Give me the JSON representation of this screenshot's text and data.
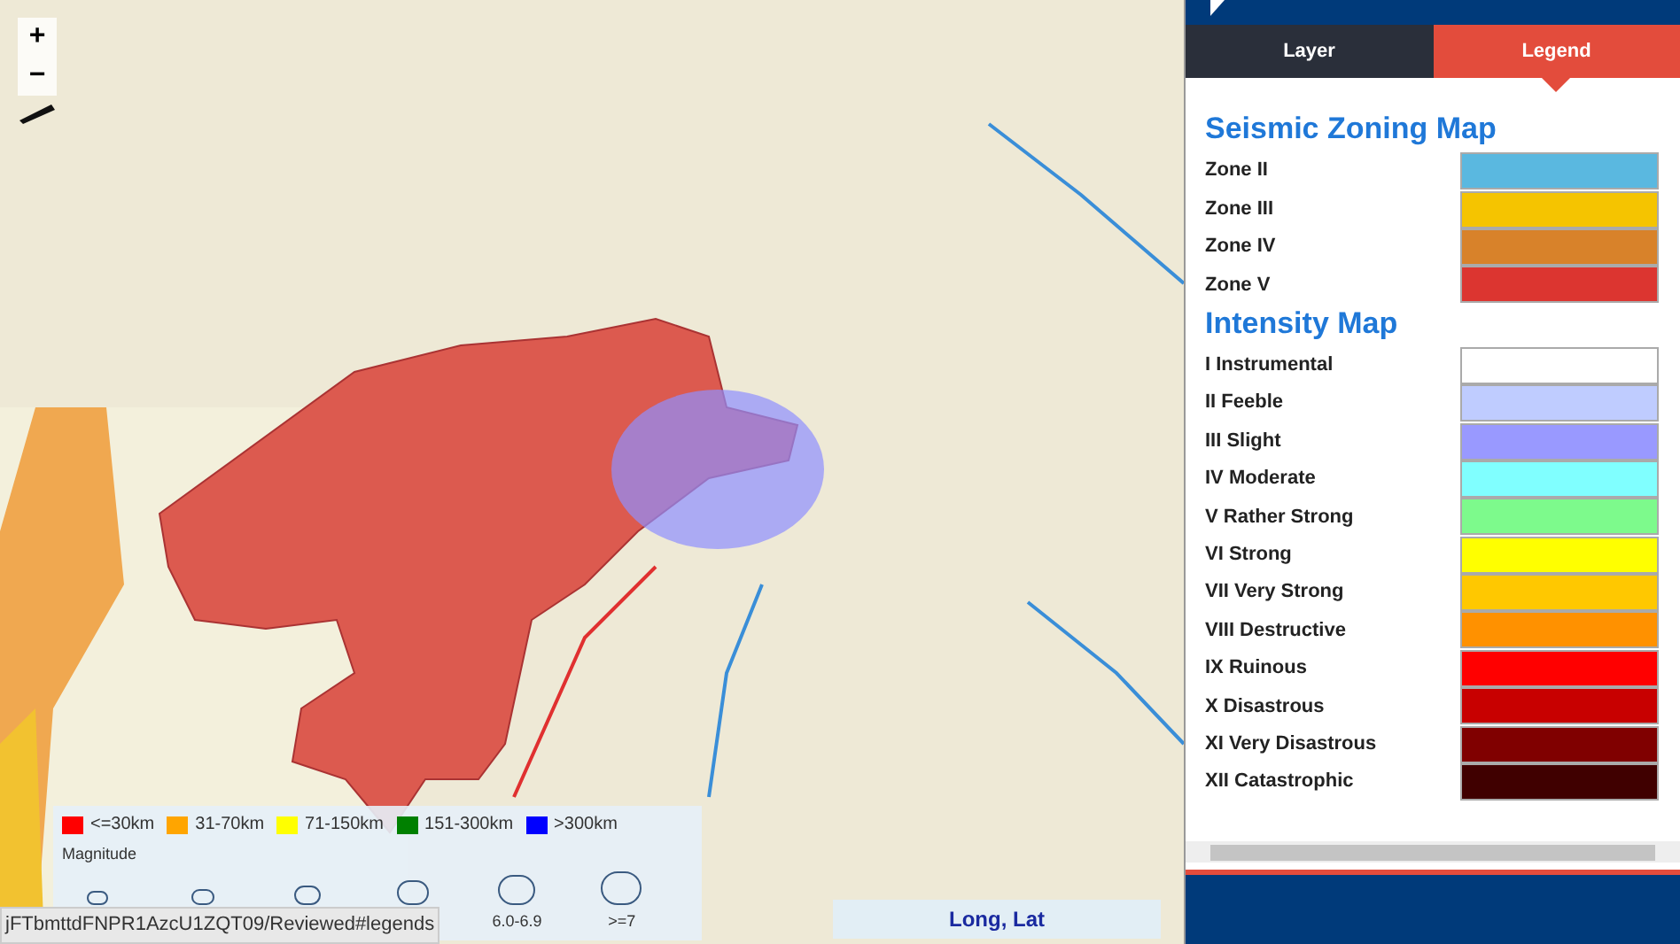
{
  "map": {
    "depth_legend": [
      {
        "label": "<=30km",
        "color": "#ff0000"
      },
      {
        "label": "31-70km",
        "color": "#ffa500"
      },
      {
        "label": "71-150km",
        "color": "#ffff00"
      },
      {
        "label": "151-300km",
        "color": "#008000"
      },
      {
        "label": ">300km",
        "color": "#0000ff"
      }
    ],
    "magnitude_title": "Magnitude",
    "magnitude_labels": [
      "6.0-6.9",
      ">=7"
    ],
    "coordinates": "Long, Lat",
    "zoom_in": "+",
    "zoom_out": "−"
  },
  "status_url": "jFTbmttdFNPR1AzcU1ZQT09/Reviewed#legends",
  "panel": {
    "tabs": [
      {
        "label": "Layer",
        "selected": false
      },
      {
        "label": "Legend",
        "selected": true
      }
    ],
    "sections": [
      {
        "title": "Seismic Zoning Map",
        "items": [
          {
            "label": "Zone II",
            "color": "#5ab8e0"
          },
          {
            "label": "Zone III",
            "color": "#f5c400"
          },
          {
            "label": "Zone IV",
            "color": "#d8822a"
          },
          {
            "label": "Zone V",
            "color": "#dc3530"
          }
        ]
      },
      {
        "title": "Intensity Map",
        "items": [
          {
            "label": "I Instrumental",
            "color": "#ffffff"
          },
          {
            "label": "II Feeble",
            "color": "#bfccff"
          },
          {
            "label": "III Slight",
            "color": "#9999ff"
          },
          {
            "label": "IV Moderate",
            "color": "#80ffff"
          },
          {
            "label": "V Rather Strong",
            "color": "#7dfa8c"
          },
          {
            "label": "VI Strong",
            "color": "#ffff00"
          },
          {
            "label": "VII Very Strong",
            "color": "#ffc800"
          },
          {
            "label": "VIII Destructive",
            "color": "#ff9100"
          },
          {
            "label": "IX Ruinous",
            "color": "#ff0000"
          },
          {
            "label": "X Disastrous",
            "color": "#c80000"
          },
          {
            "label": "XI Very Disastrous",
            "color": "#800000"
          },
          {
            "label": "XII Catastrophic",
            "color": "#400000"
          }
        ]
      }
    ]
  }
}
